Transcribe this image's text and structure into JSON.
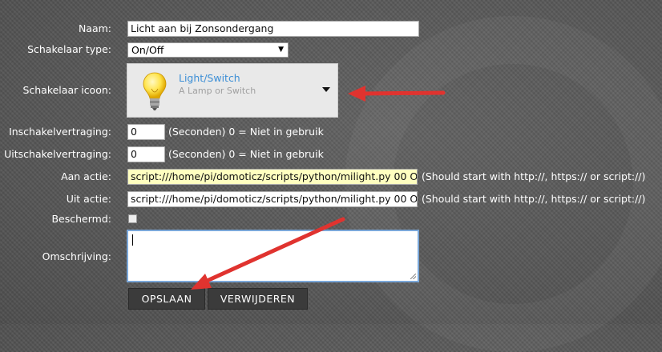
{
  "form": {
    "name_label": "Naam:",
    "name_value": "Licht aan bij Zonsondergang",
    "switch_type_label": "Schakelaar type:",
    "switch_type_value": "On/Off",
    "switch_icon_label": "Schakelaar icoon:",
    "icon_title": "Light/Switch",
    "icon_subtitle": "A Lamp or Switch",
    "on_delay_label": "Inschakelvertraging:",
    "on_delay_value": "0",
    "on_delay_hint": "(Seconden) 0 = Niet in gebruik",
    "off_delay_label": "Uitschakelvertraging:",
    "off_delay_value": "0",
    "off_delay_hint": "(Seconden) 0 = Niet in gebruik",
    "on_action_label": "Aan actie:",
    "on_action_value": "script:///home/pi/domoticz/scripts/python/milight.py 00 O",
    "on_action_hint": "(Should start with http://, https:// or script://)",
    "off_action_label": "Uit actie:",
    "off_action_value": "script:///home/pi/domoticz/scripts/python/milight.py 00 O",
    "off_action_hint": "(Should start with http://, https:// or script://)",
    "protected_label": "Beschermd:",
    "description_label": "Omschrijving:",
    "save_label": "OPSLAAN",
    "delete_label": "VERWIJDEREN"
  },
  "colors": {
    "arrow": "#e0332f",
    "link": "#3d8fd6"
  }
}
